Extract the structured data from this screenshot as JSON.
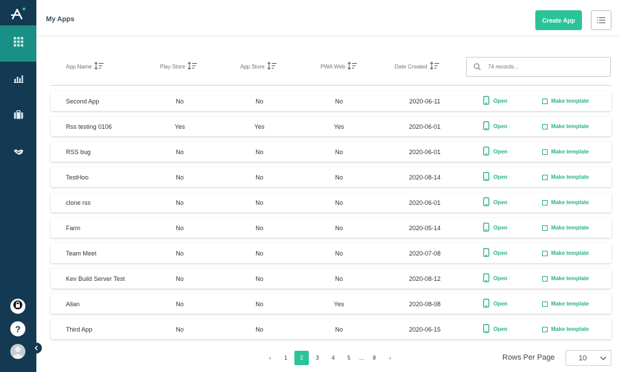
{
  "header": {
    "title": "My Apps",
    "create_button": "Create App"
  },
  "table": {
    "columns": {
      "name": "App Name",
      "play": "Play Store",
      "appstore": "App Store",
      "pwa": "PWA Web",
      "date": "Date Created"
    },
    "search_placeholder": "74 records...",
    "open_label": "Open",
    "template_label": "Make template",
    "rows": [
      {
        "name": "Second App",
        "play": "No",
        "appstore": "No",
        "pwa": "No",
        "date": "2020-06-11"
      },
      {
        "name": "Rss testing 0106",
        "play": "Yes",
        "appstore": "Yes",
        "pwa": "Yes",
        "date": "2020-06-01"
      },
      {
        "name": "RSS bug",
        "play": "No",
        "appstore": "No",
        "pwa": "No",
        "date": "2020-06-01"
      },
      {
        "name": "TestHoo",
        "play": "No",
        "appstore": "No",
        "pwa": "No",
        "date": "2020-08-14"
      },
      {
        "name": "clone rss",
        "play": "No",
        "appstore": "No",
        "pwa": "No",
        "date": "2020-06-01"
      },
      {
        "name": "Farm",
        "play": "No",
        "appstore": "No",
        "pwa": "No",
        "date": "2020-05-14"
      },
      {
        "name": "Team Meet",
        "play": "No",
        "appstore": "No",
        "pwa": "No",
        "date": "2020-07-08"
      },
      {
        "name": "Kev Build Server Test",
        "play": "No",
        "appstore": "No",
        "pwa": "No",
        "date": "2020-08-12"
      },
      {
        "name": "Allan",
        "play": "No",
        "appstore": "No",
        "pwa": "Yes",
        "date": "2020-08-08"
      },
      {
        "name": "Third App",
        "play": "No",
        "appstore": "No",
        "pwa": "No",
        "date": "2020-06-15"
      }
    ]
  },
  "pagination": {
    "prev": "‹",
    "next": "›",
    "pages": [
      "1",
      "2",
      "3",
      "4",
      "5",
      "...",
      "8"
    ],
    "current": "2",
    "rows_per_page_label": "Rows Per Page",
    "rows_per_page_value": "10"
  },
  "sidebar": {
    "items": [
      "apps-grid-icon",
      "analytics-chart-icon",
      "briefcase-icon",
      "handshake-icon"
    ],
    "bottom": [
      "lock-icon",
      "help-icon",
      "user-avatar"
    ],
    "active_color": "#1a8f86",
    "background": "#133a52"
  },
  "accent_color": "#2bc49a"
}
